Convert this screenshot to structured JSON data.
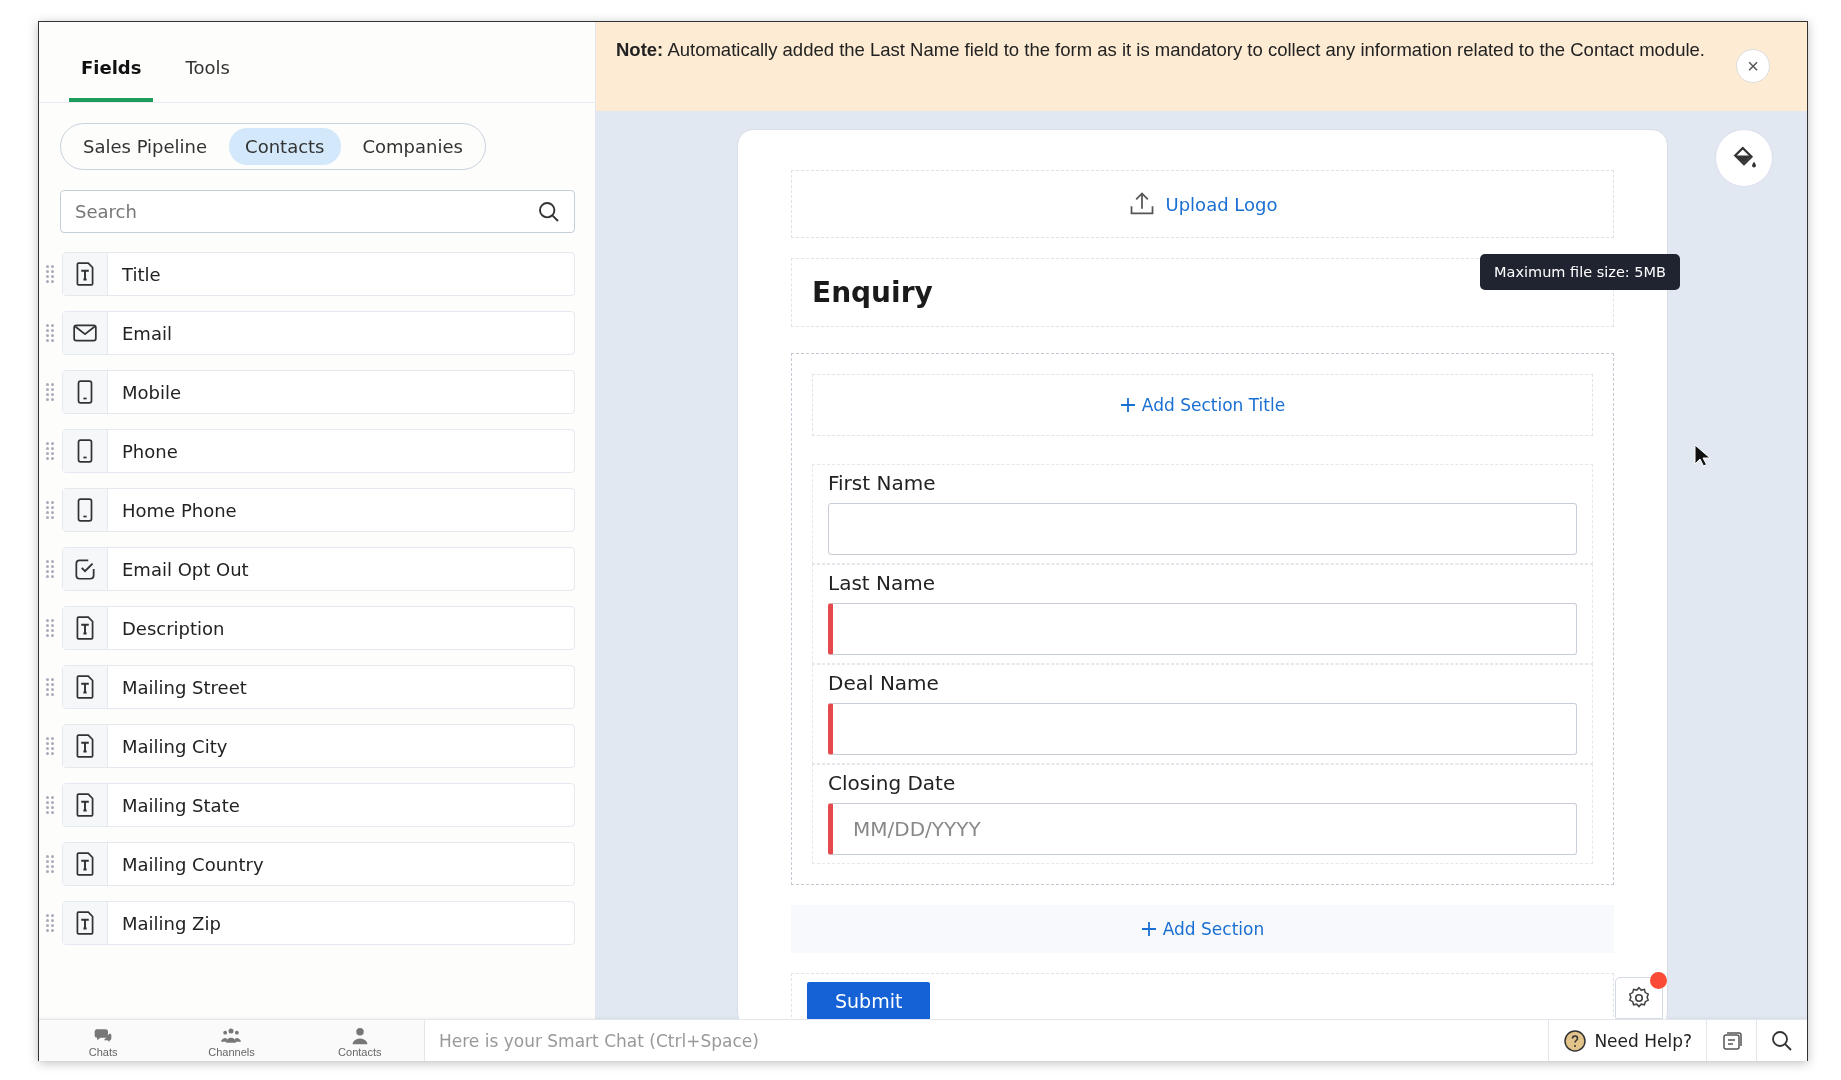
{
  "sidebar": {
    "tabs": [
      {
        "label": "Fields",
        "selected": true
      },
      {
        "label": "Tools",
        "selected": false
      }
    ],
    "modules": [
      {
        "label": "Sales Pipeline",
        "selected": false
      },
      {
        "label": "Contacts",
        "selected": true
      },
      {
        "label": "Companies",
        "selected": false
      }
    ],
    "search": {
      "placeholder": "Search"
    },
    "fields": [
      {
        "kind": "text",
        "label": "Title"
      },
      {
        "kind": "email",
        "label": "Email"
      },
      {
        "kind": "phone",
        "label": "Mobile"
      },
      {
        "kind": "phone",
        "label": "Phone"
      },
      {
        "kind": "phone",
        "label": "Home Phone"
      },
      {
        "kind": "checkbox",
        "label": "Email Opt Out"
      },
      {
        "kind": "text",
        "label": "Description"
      },
      {
        "kind": "text",
        "label": "Mailing Street"
      },
      {
        "kind": "text",
        "label": "Mailing City"
      },
      {
        "kind": "text",
        "label": "Mailing State"
      },
      {
        "kind": "text",
        "label": "Mailing Country"
      },
      {
        "kind": "text",
        "label": "Mailing Zip"
      }
    ]
  },
  "note": {
    "text": "**Note:**  Automatically added the Last Name field to the form as it is mandatory to collect any information related to the Contact module.",
    "close": "×"
  },
  "form": {
    "upload_logo": "Upload Logo",
    "tooltip": "Maximum file size: 5MB",
    "title": "Enquiry",
    "add_section_title": "Add Section Title",
    "fields": [
      {
        "label": "First Name",
        "required": false
      },
      {
        "label": "Last Name",
        "required": true
      },
      {
        "label": "Deal Name",
        "required": true
      },
      {
        "label": "Closing Date",
        "required": true,
        "placeholder": "MM/DD/YYYY"
      }
    ],
    "add_section": "Add Section",
    "submit": "Submit",
    "settings_alert": true
  },
  "bottom_bar": {
    "nav": [
      {
        "kind": "chats",
        "label": "Chats"
      },
      {
        "kind": "channels",
        "label": "Channels"
      },
      {
        "kind": "contacts",
        "label": "Contacts"
      }
    ],
    "chat_placeholder": "Here is your Smart Chat (Ctrl+Space)",
    "help": "Need Help?"
  }
}
